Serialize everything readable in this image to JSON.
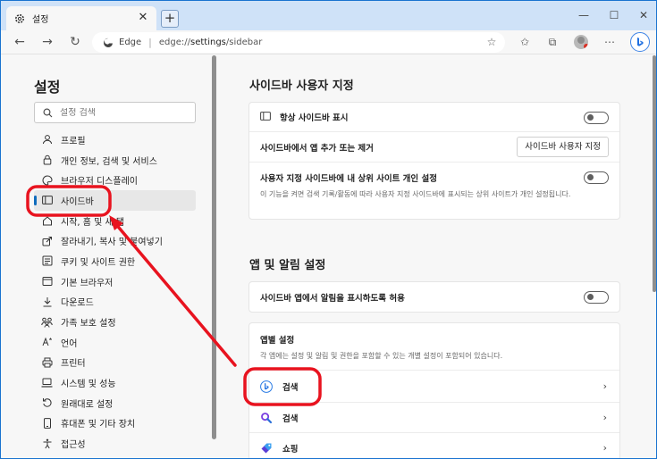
{
  "tab": {
    "title": "설정"
  },
  "address": {
    "site": "Edge",
    "url_prefix": "edge://",
    "url_main": "settings",
    "url_suffix": "/sidebar"
  },
  "nav": {
    "title": "설정",
    "search_placeholder": "설정 검색",
    "items": [
      {
        "label": "프로필",
        "icon": "profile-icon"
      },
      {
        "label": "개인 정보, 검색 및 서비스",
        "icon": "lock-icon"
      },
      {
        "label": "브라우저 디스플레이",
        "icon": "palette-icon"
      },
      {
        "label": "사이드바",
        "icon": "sidebar-icon",
        "active": true
      },
      {
        "label": "시작, 홈 및 새 탭",
        "icon": "home-icon"
      },
      {
        "label": "잘라내기, 복사 및 붙여넣기",
        "icon": "share-icon"
      },
      {
        "label": "쿠키 및 사이트 권한",
        "icon": "cookie-icon"
      },
      {
        "label": "기본 브라우저",
        "icon": "browser-icon"
      },
      {
        "label": "다운로드",
        "icon": "download-icon"
      },
      {
        "label": "가족 보호 설정",
        "icon": "family-icon"
      },
      {
        "label": "언어",
        "icon": "language-icon"
      },
      {
        "label": "프린터",
        "icon": "printer-icon"
      },
      {
        "label": "시스템 및 성능",
        "icon": "laptop-icon"
      },
      {
        "label": "원래대로 설정",
        "icon": "reset-icon"
      },
      {
        "label": "휴대폰 및 기타 장치",
        "icon": "phone-icon"
      },
      {
        "label": "접근성",
        "icon": "accessibility-icon"
      }
    ]
  },
  "main": {
    "sidebar_section": {
      "title": "사이드바 사용자 지정",
      "always_show": "항상 사이드바 표시",
      "add_remove_apps": "사이드바에서 앱 추가 또는 제거",
      "customize_button": "사이드바 사용자 지정",
      "personalize_title": "사용자 지정 사이드바에 내 상위 사이트 개인 설정",
      "personalize_desc": "이 기능을 켜면 검색 기록/활동에 따라 사용자 지정 사이드바에 표시되는 상위 사이트가 개인 설정됩니다."
    },
    "apps_section": {
      "title": "앱 및 알림 설정",
      "allow_notifications": "사이드바 앱에서 알림을 표시하도록 허용",
      "per_app_title": "앱별 설정",
      "per_app_desc": "각 앱에는 설정 및 알림 및 권한을 포함할 수 있는 개별 설정이 포함되어 있습니다.",
      "apps": [
        {
          "label": "검색",
          "icon": "bing-icon"
        },
        {
          "label": "검색",
          "icon": "magnifier-icon"
        },
        {
          "label": "쇼핑",
          "icon": "shopping-tag-icon"
        }
      ]
    }
  },
  "colors": {
    "accent": "#0f6cbd",
    "annotation": "#e8131f",
    "titlebar": "#cfe2f8"
  }
}
